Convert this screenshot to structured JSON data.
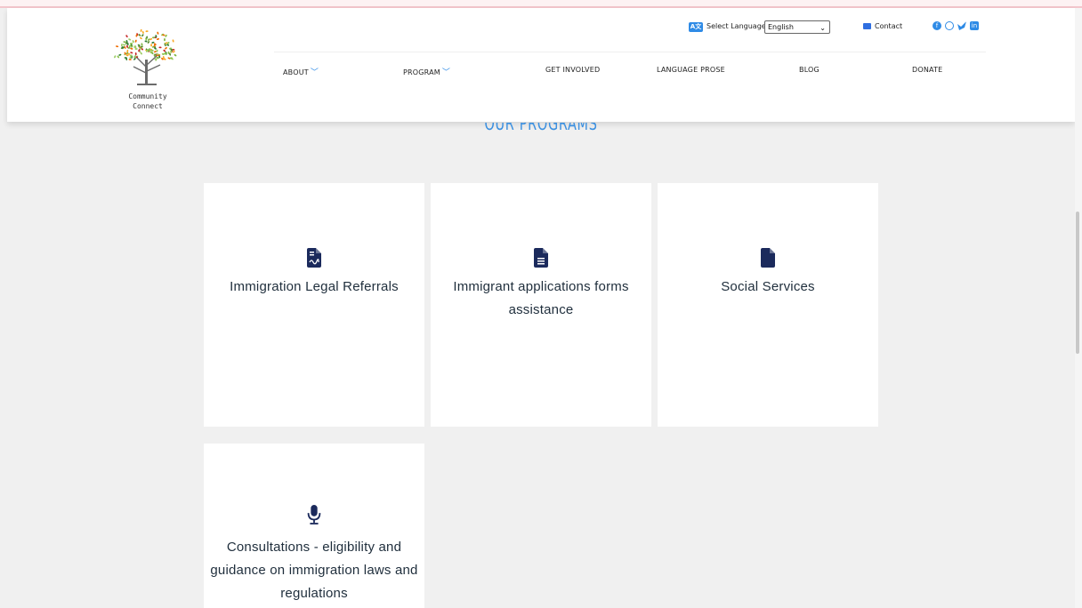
{
  "brand": {
    "name_line1": "Community",
    "name_line2": "Connect"
  },
  "utility": {
    "language_icon": "A文",
    "language_label": "Select Language",
    "language_value": "English",
    "contact_label": "Contact",
    "social_icons": [
      "facebook-icon",
      "instagram-icon",
      "twitter-icon",
      "linkedin-icon"
    ]
  },
  "nav": {
    "items": [
      {
        "label": "ABOUT",
        "has_dropdown": true
      },
      {
        "label": "PROGRAM",
        "has_dropdown": true
      },
      {
        "label": "GET INVOLVED",
        "has_dropdown": false
      },
      {
        "label": "LANGUAGE PROSE",
        "has_dropdown": false
      },
      {
        "label": "BLOG",
        "has_dropdown": false
      },
      {
        "label": "DONATE",
        "has_dropdown": false
      }
    ]
  },
  "section": {
    "title": "OUR PROGRAMS"
  },
  "programs": [
    {
      "title": "Immigration Legal Referrals",
      "icon": "file-signature-icon"
    },
    {
      "title": "Immigrant applications forms assistance",
      "icon": "file-lines-icon"
    },
    {
      "title": "Social Services",
      "icon": "file-icon"
    },
    {
      "title": "Consultations - eligibility and guidance on immigration laws and regulations",
      "icon": "microphone-icon"
    }
  ],
  "colors": {
    "accent": "#2f8be6",
    "icon": "#1b2a5c",
    "card_text": "#1f2e3c",
    "page_bg": "#f0f0f0"
  }
}
